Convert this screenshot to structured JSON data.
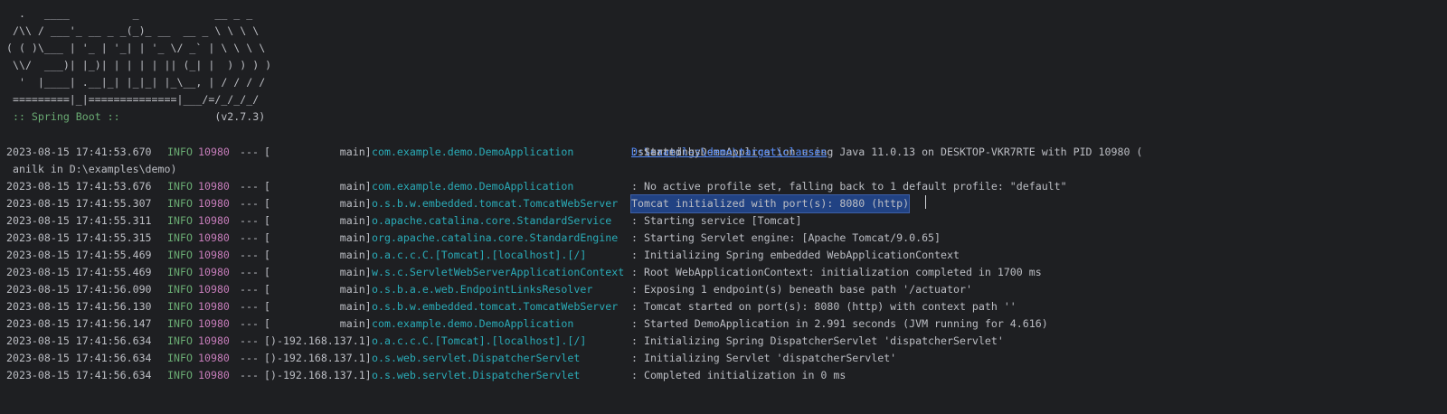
{
  "banner": {
    "lines": [
      "  .   ____          _            __ _ _",
      " /\\\\ / ___'_ __ _ _(_)_ __  __ _ \\ \\ \\ \\",
      "( ( )\\___ | '_ | '_| | '_ \\/ _` | \\ \\ \\ \\",
      " \\\\/  ___)| |_)| | | | | || (_| |  ) ) ) )",
      "  '  |____| .__|_| |_|_| |_\\__, | / / / /",
      " =========|_|==============|___/=/_/_/_/"
    ],
    "spring_label": " :: Spring Boot ::",
    "version": "               (v2.7.3)"
  },
  "logs": [
    {
      "ts": "2023-08-15 17:41:53.670",
      "level": "INFO",
      "pid": "10980",
      "sep": "---",
      "thread": "[           main]",
      "logger": "com.example.demo.DemoApplication",
      "msg_pre": ": Starting DemoApplication using Java 11.0.13 on DESKTOP-VKR7RTE with PID 10980 (",
      "link": "D:\\examples\\demo\\target\\classes",
      "msg_post": " started by",
      "continuation": " anilk in D:\\examples\\demo)"
    },
    {
      "ts": "2023-08-15 17:41:53.676",
      "level": "INFO",
      "pid": "10980",
      "sep": "---",
      "thread": "[           main]",
      "logger": "com.example.demo.DemoApplication",
      "msg": ": No active profile set, falling back to 1 default profile: \"default\""
    },
    {
      "ts": "2023-08-15 17:41:55.307",
      "level": "INFO",
      "pid": "10980",
      "sep": "---",
      "thread": "[           main]",
      "logger": "o.s.b.w.embedded.tomcat.TomcatWebServer",
      "msg_prefix": ": ",
      "msg_selected": "Tomcat initialized with port(s): 8080 (http)"
    },
    {
      "ts": "2023-08-15 17:41:55.311",
      "level": "INFO",
      "pid": "10980",
      "sep": "---",
      "thread": "[           main]",
      "logger": "o.apache.catalina.core.StandardService",
      "msg": ": Starting service [Tomcat]"
    },
    {
      "ts": "2023-08-15 17:41:55.315",
      "level": "INFO",
      "pid": "10980",
      "sep": "---",
      "thread": "[           main]",
      "logger": "org.apache.catalina.core.StandardEngine",
      "msg": ": Starting Servlet engine: [Apache Tomcat/9.0.65]"
    },
    {
      "ts": "2023-08-15 17:41:55.469",
      "level": "INFO",
      "pid": "10980",
      "sep": "---",
      "thread": "[           main]",
      "logger": "o.a.c.c.C.[Tomcat].[localhost].[/]",
      "msg": ": Initializing Spring embedded WebApplicationContext"
    },
    {
      "ts": "2023-08-15 17:41:55.469",
      "level": "INFO",
      "pid": "10980",
      "sep": "---",
      "thread": "[           main]",
      "logger": "w.s.c.ServletWebServerApplicationContext",
      "msg": ": Root WebApplicationContext: initialization completed in 1700 ms"
    },
    {
      "ts": "2023-08-15 17:41:56.090",
      "level": "INFO",
      "pid": "10980",
      "sep": "---",
      "thread": "[           main]",
      "logger": "o.s.b.a.e.web.EndpointLinksResolver",
      "msg": ": Exposing 1 endpoint(s) beneath base path '/actuator'"
    },
    {
      "ts": "2023-08-15 17:41:56.130",
      "level": "INFO",
      "pid": "10980",
      "sep": "---",
      "thread": "[           main]",
      "logger": "o.s.b.w.embedded.tomcat.TomcatWebServer",
      "msg": ": Tomcat started on port(s): 8080 (http) with context path ''"
    },
    {
      "ts": "2023-08-15 17:41:56.147",
      "level": "INFO",
      "pid": "10980",
      "sep": "---",
      "thread": "[           main]",
      "logger": "com.example.demo.DemoApplication",
      "msg": ": Started DemoApplication in 2.991 seconds (JVM running for 4.616)"
    },
    {
      "ts": "2023-08-15 17:41:56.634",
      "level": "INFO",
      "pid": "10980",
      "sep": "---",
      "thread": "[)-192.168.137.1]",
      "logger": "o.a.c.c.C.[Tomcat].[localhost].[/]",
      "msg": ": Initializing Spring DispatcherServlet 'dispatcherServlet'"
    },
    {
      "ts": "2023-08-15 17:41:56.634",
      "level": "INFO",
      "pid": "10980",
      "sep": "---",
      "thread": "[)-192.168.137.1]",
      "logger": "o.s.web.servlet.DispatcherServlet",
      "msg": ": Initializing Servlet 'dispatcherServlet'"
    },
    {
      "ts": "2023-08-15 17:41:56.634",
      "level": "INFO",
      "pid": "10980",
      "sep": "---",
      "thread": "[)-192.168.137.1]",
      "logger": "o.s.web.servlet.DispatcherServlet",
      "msg": ": Completed initialization in 0 ms"
    }
  ],
  "colors": {
    "background": "#1e1f22",
    "text": "#bcbec4",
    "level_info": "#6aab73",
    "pid": "#c77dbb",
    "logger": "#2aacb8",
    "link": "#548af7",
    "selection": "#214283"
  }
}
